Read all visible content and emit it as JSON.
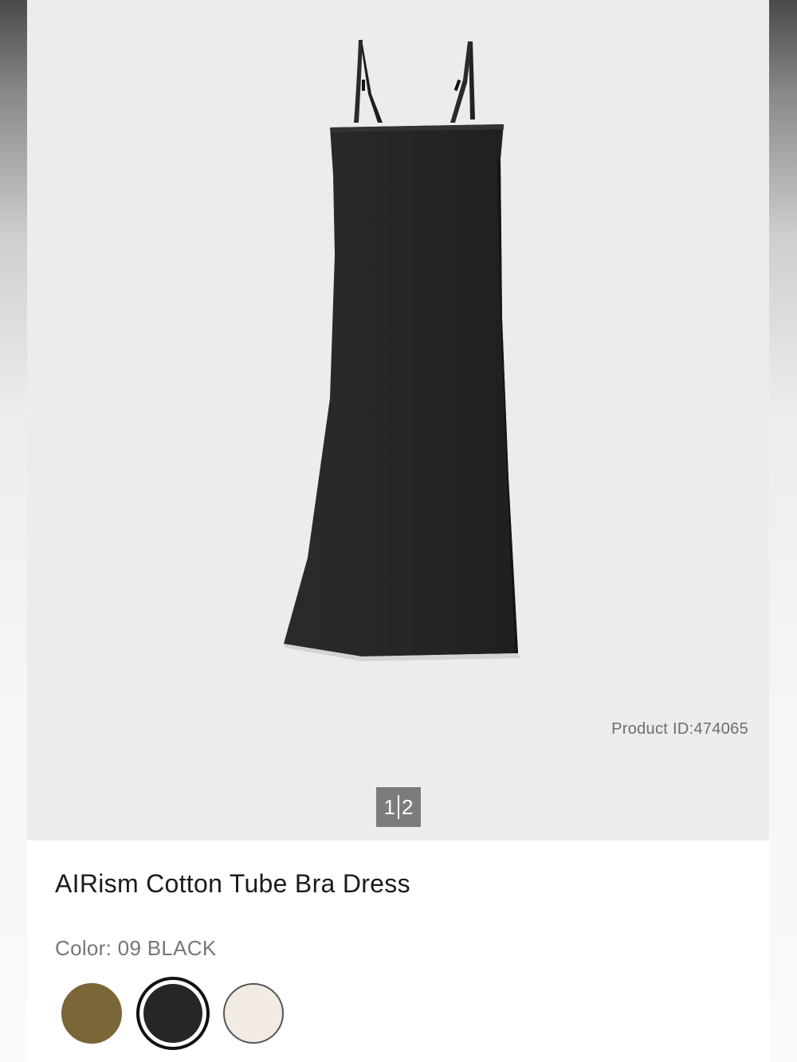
{
  "product": {
    "product_id_text": "Product ID:474065",
    "title": "AIRism Cotton Tube Bra Dress",
    "color_label": "Color: 09 BLACK"
  },
  "gallery": {
    "current_page": "1",
    "total_pages": "2",
    "image_subject": "black tube bra dress",
    "background_color": "#ebecee"
  },
  "swatches": [
    {
      "name": "olive",
      "color": "#7a6636",
      "selected": false
    },
    {
      "name": "black",
      "color": "#262626",
      "selected": true
    },
    {
      "name": "cream",
      "color": "#f1ebe3",
      "selected": false
    }
  ],
  "colors": {
    "dress": "#272727",
    "text_primary": "#1b1b1b",
    "text_secondary": "#767676",
    "pager_bg": "#7c7c7c"
  }
}
